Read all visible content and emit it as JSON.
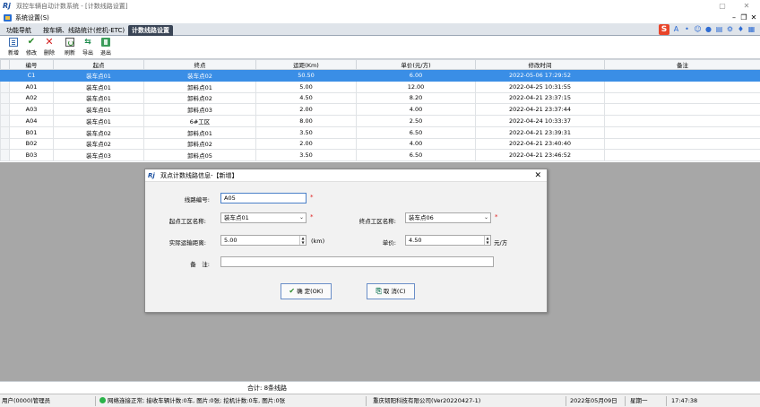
{
  "window": {
    "title": "双控车辆自动计数系统 - [计数线路设置]",
    "logo": "Rj",
    "minimize": "▢",
    "close": "✕"
  },
  "menu": {
    "label": "系统设置(S)",
    "mdi_min": "–",
    "mdi_restore": "❐",
    "mdi_close": "✕"
  },
  "tabs": [
    {
      "label": "功能导航"
    },
    {
      "label": "按车辆、线路统计(挖机-ETC)"
    },
    {
      "label": "计数线路设置"
    }
  ],
  "ime": {
    "logo": "S",
    "items": [
      "A",
      "•",
      "☺",
      "🎤",
      "▦",
      "⚐",
      "👕",
      "▦"
    ]
  },
  "toolbar": {
    "new": "新增",
    "edit": "修改",
    "delete": "删除",
    "refresh": "刷新",
    "export": "导出",
    "exit": "退出"
  },
  "table": {
    "headers": [
      "编号",
      "起点",
      "终点",
      "运距(Km)",
      "单价(元/方)",
      "修改时间",
      "备注"
    ],
    "rows": [
      [
        "C1",
        "装车点01",
        "装车点02",
        "50.50",
        "6.00",
        "2022-05-06 17:29:52",
        ""
      ],
      [
        "A01",
        "装车点01",
        "卸料点01",
        "5.00",
        "12.00",
        "2022-04-25 10:31:55",
        ""
      ],
      [
        "A02",
        "装车点01",
        "卸料点02",
        "4.50",
        "8.20",
        "2022-04-21 23:37:15",
        ""
      ],
      [
        "A03",
        "装车点01",
        "卸料点03",
        "2.00",
        "4.00",
        "2022-04-21 23:37:44",
        ""
      ],
      [
        "A04",
        "装车点01",
        "6#工区",
        "8.00",
        "2.50",
        "2022-04-24 10:33:37",
        ""
      ],
      [
        "B01",
        "装车点02",
        "卸料点01",
        "3.50",
        "6.50",
        "2022-04-21 23:39:31",
        ""
      ],
      [
        "B02",
        "装车点02",
        "卸料点02",
        "2.00",
        "4.00",
        "2022-04-21 23:40:40",
        ""
      ],
      [
        "B03",
        "装车点03",
        "卸料点05",
        "3.50",
        "6.50",
        "2022-04-21 23:46:52",
        ""
      ]
    ],
    "selected_index": 0
  },
  "dialog": {
    "title": "双点计数线路信息-【新增】",
    "close": "✕",
    "route_no_label": "线路编号:",
    "route_no_value": "A05",
    "start_label": "起点工区名称:",
    "start_value": "装车点01",
    "end_label": "终点工区名称:",
    "end_value": "装车点06",
    "distance_label": "实际运输距离:",
    "distance_value": "5.00",
    "distance_unit": "(km)",
    "price_label": "单价:",
    "price_value": "4.50",
    "price_unit": "元/方",
    "remark_label": "备　注:",
    "remark_value": "",
    "required_mark": "*",
    "ok_label": "确 定(OK)",
    "cancel_label": "取 消(C)"
  },
  "summary": "合计: 8条线路",
  "status": {
    "user": "用户(0000)管理员",
    "network": "网络连接正常; 接收车辆计数:0车, 图片:0张; 挖机计数:0车, 图片:0张",
    "company": "重庆韧阳科技有限公司(Ver20220427-1)",
    "date": "2022年05月09日",
    "weekday": "星期一",
    "time": "17:47:38"
  },
  "colors": {
    "selected_row": "#3a8ee6",
    "active_tab": "#3a4556",
    "gray_workspace": "#a7a7a7",
    "required": "#e02020",
    "network_ok": "#2bb34a"
  }
}
